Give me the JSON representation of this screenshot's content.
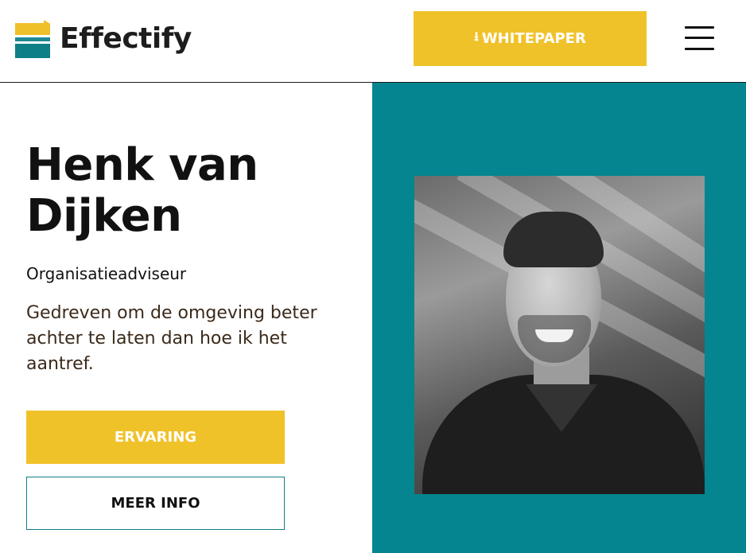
{
  "header": {
    "logo_text": "Effectify",
    "whitepaper_icon": "download-icon",
    "whitepaper_glyph": "⭳",
    "whitepaper_label": "WHITEPAPER",
    "menu_icon": "hamburger-menu-icon"
  },
  "profile": {
    "name": "Henk van Dijken",
    "role": "Organisatieadviseur",
    "tagline": "Gedreven om de omgeving beter achter te laten dan hoe ik het aantref.",
    "primary_button_label": "ERVARING",
    "secondary_button_label": "MEER INFO"
  },
  "colors": {
    "accent_yellow": "#f0c22a",
    "teal": "#05858f",
    "text": "#111111"
  }
}
